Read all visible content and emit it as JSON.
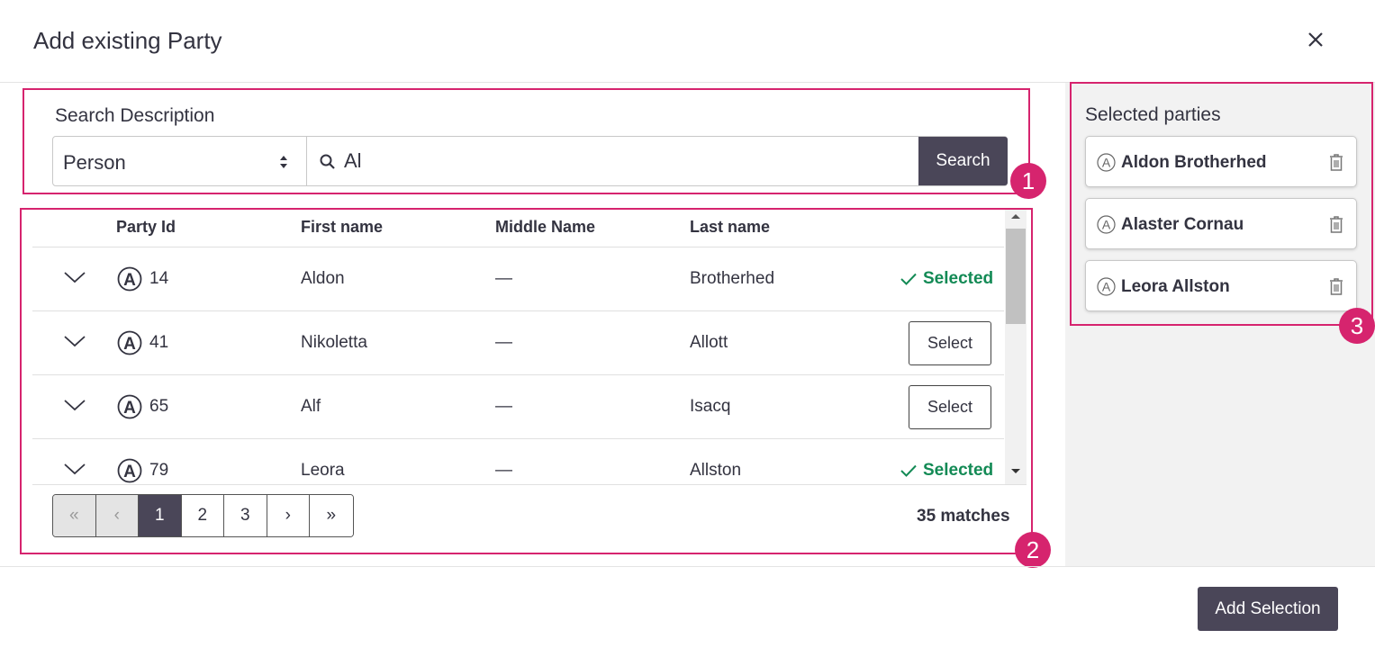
{
  "dialog": {
    "title": "Add existing Party",
    "close_icon": "close-icon"
  },
  "search": {
    "label": "Search Description",
    "type_value": "Person",
    "query": "Al",
    "button_label": "Search"
  },
  "table": {
    "columns": [
      "Party Id",
      "First name",
      "Middle Name",
      "Last name"
    ],
    "rows": [
      {
        "id": "14",
        "first": "Aldon",
        "middle": "—",
        "last": "Brotherhed",
        "status": "Selected"
      },
      {
        "id": "41",
        "first": "Nikoletta",
        "middle": "—",
        "last": "Allott",
        "action": "Select"
      },
      {
        "id": "65",
        "first": "Alf",
        "middle": "—",
        "last": "Isacq",
        "action": "Select"
      },
      {
        "id": "79",
        "first": "Leora",
        "middle": "—",
        "last": "Allston",
        "status": "Selected"
      }
    ]
  },
  "pagination": {
    "first": "«",
    "prev": "‹",
    "pages": [
      "1",
      "2",
      "3"
    ],
    "active_page": "1",
    "next": "›",
    "last": "»",
    "matches": "35 matches"
  },
  "selected_panel": {
    "title": "Selected parties",
    "items": [
      "Aldon Brotherhed",
      "Alaster Cornau",
      "Leora Allston"
    ]
  },
  "callouts": [
    "1",
    "2",
    "3"
  ],
  "footer": {
    "add_label": "Add Selection"
  },
  "colors": {
    "accent": "#d6246e",
    "primary": "#4a4658",
    "selected": "#138a55",
    "panel_bg": "#f2f2f2"
  }
}
